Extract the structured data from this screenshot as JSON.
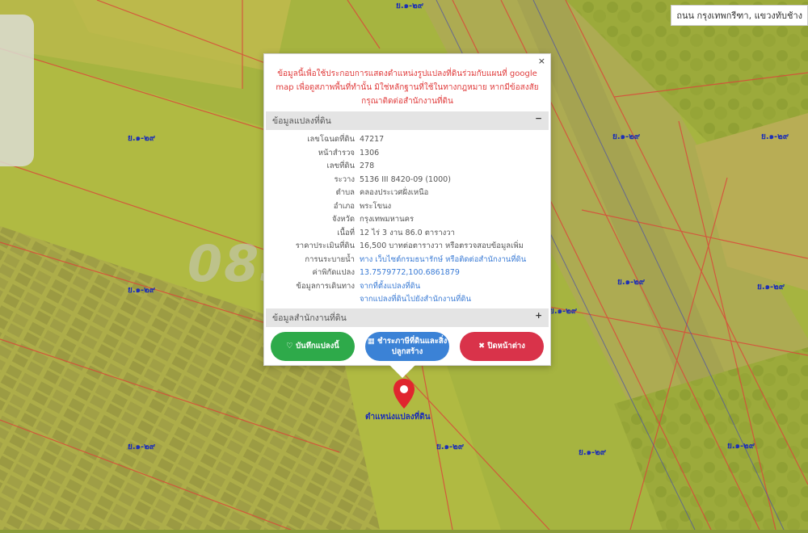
{
  "address": "ถนน กรุงเทพกรีฑา, แขวงทับช้าง",
  "zone_labels": [
    "ย.๑-๒๙",
    "ย.๑-๒๙",
    "ย.๑-๒๙",
    "ย.๑-๒๙",
    "ย.๑-๒๙",
    "ย.๑-๒๙",
    "ย.๑-๒๙",
    "ย.๑-๒๙",
    "ย.๑-๒๙",
    "ย.๑-๒๙",
    "ย.๑-๒๙",
    "ย.๑-๒๙"
  ],
  "popup": {
    "close": "×",
    "notice": "ข้อมูลนี้เพื่อใช้ประกอบการแสดงตำแหน่งรูปแปลงที่ดินร่วมกับแผนที่ google map เพื่อดูสภาพพื้นที่ทำนั้น มิใช่หลักฐานที่ใช้ในทางกฎหมาย หากมีข้อสงสัย กรุณาติดต่อสำนักงานที่ดิน",
    "section1_title": "ข้อมูลแปลงที่ดิน",
    "section1_toggle": "−",
    "rows": [
      {
        "k": "เลขโฉนดที่ดิน",
        "v": "47217"
      },
      {
        "k": "หน้าสำรวจ",
        "v": "1306"
      },
      {
        "k": "เลขที่ดิน",
        "v": "278"
      },
      {
        "k": "ระวาง",
        "v": "5136 III 8420-09 (1000)"
      },
      {
        "k": "ตำบล",
        "v": "คลองประเวศฝั่งเหนือ"
      },
      {
        "k": "อำเภอ",
        "v": "พระโขนง"
      },
      {
        "k": "จังหวัด",
        "v": "กรุงเทพมหานคร"
      },
      {
        "k": "เนื้อที่",
        "v": "12 ไร่ 3 งาน 86.0 ตารางวา"
      },
      {
        "k": "ราคาประเมินที่ดิน",
        "v": "16,500 บาทต่อตารางวา หรือตรวจสอบข้อมูลเพิ่ม"
      },
      {
        "k": "การนระบายน้ำ",
        "v": "ทาง เว็บไซต์กรมธนารักษ์ หรือติดต่อสำนักงานที่ดิน"
      },
      {
        "k": "ค่าพิกัดแปลง",
        "v": "13.7579772,100.6861879"
      },
      {
        "k": "ข้อมูลการเดินทาง",
        "v": "จากที่ตั้งแปลงที่ดิน"
      },
      {
        "k": "",
        "v": "จากแปลงที่ดินไปยังสำนักงานที่ดิน"
      }
    ],
    "section2_title": "ข้อมูลสำนักงานที่ดิน",
    "section2_toggle": "+",
    "btn_save": "♡ บันทึกแปลงนี้",
    "btn_tax": "▦ ชำระภาษีที่ดินและสิ่งปลูกสร้าง",
    "btn_close": "✖ ปิดหน้าต่าง"
  },
  "watermark": "083-9-1505",
  "pin_label": "ตำแหน่งแปลงที่ดิน",
  "colors": {
    "tint": "#e8e04a",
    "parcel_line": "#d94a3a",
    "zone_label": "#1d2fb5"
  }
}
